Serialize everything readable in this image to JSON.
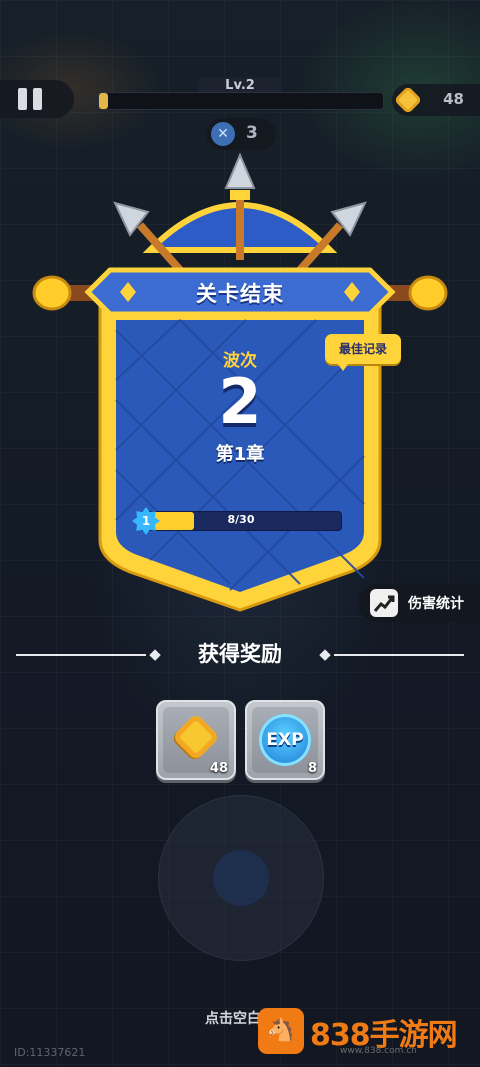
{
  "hud": {
    "level_label": "Lv.2",
    "level_progress": 0.03,
    "coins": "48",
    "kills": "3"
  },
  "panel": {
    "title": "关卡结束",
    "best_badge": "最佳记录",
    "wave_label": "波次",
    "wave_value": "2",
    "chapter": "第1章",
    "progress_level": "1",
    "progress_text": "8/30",
    "progress_fraction": 0.267
  },
  "damage_stats_label": "伤害统计",
  "rewards": {
    "title": "获得奖励",
    "items": [
      {
        "type": "gold",
        "icon": "gold-gem-icon",
        "qty": "48"
      },
      {
        "type": "exp",
        "icon": "exp-orb-icon",
        "label": "EXP",
        "qty": "8"
      }
    ]
  },
  "hint": "点击空白处",
  "uid": "ID:11337621",
  "watermark": {
    "brand": "838手游网",
    "sub": "www.838.com.cn"
  },
  "colors": {
    "gold": "#ffd33a",
    "shield_blue": "#2b5bb8",
    "accent_blue": "#36b7ff"
  }
}
